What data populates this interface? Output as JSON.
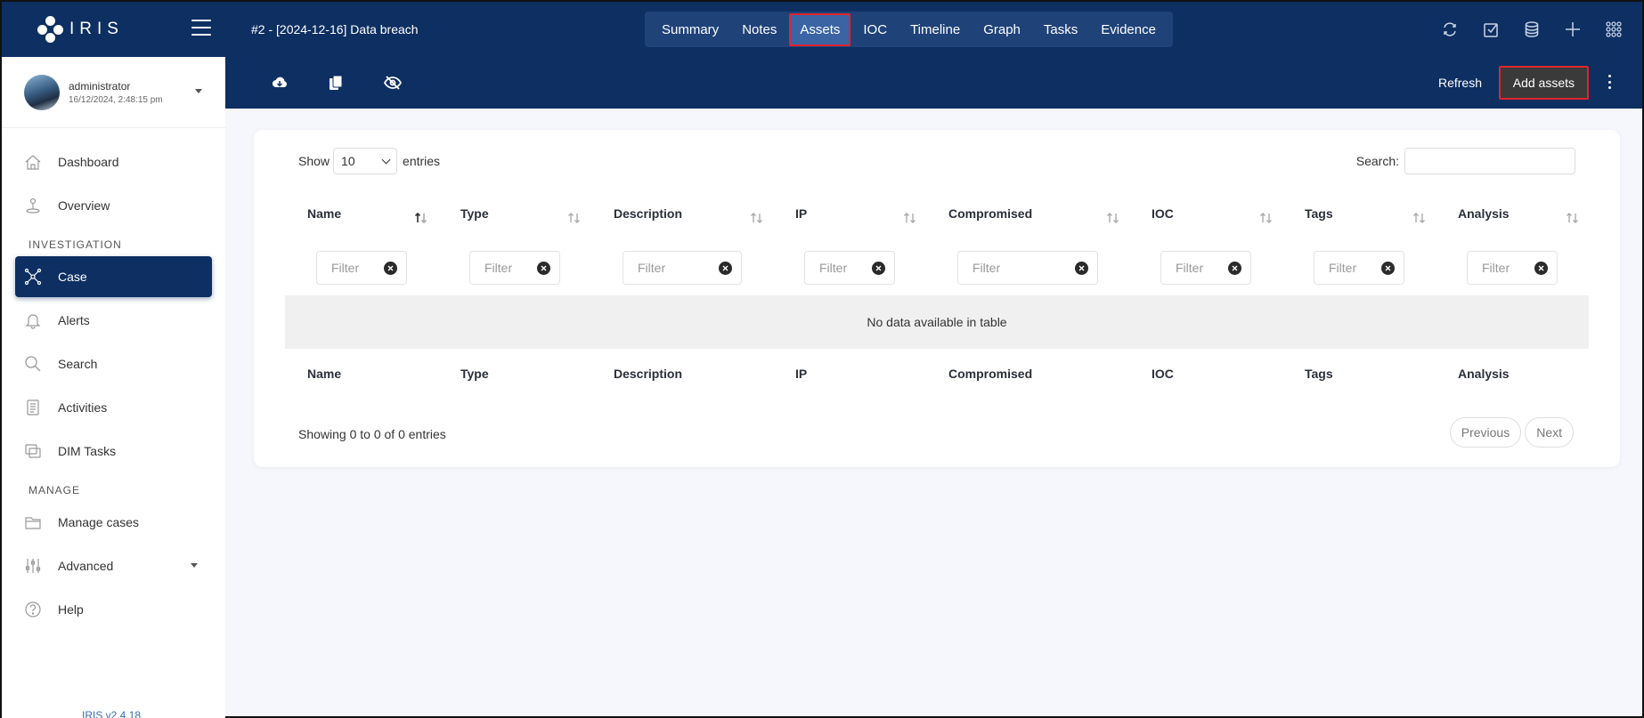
{
  "app": {
    "logo_text": "IRIS",
    "case_title": "#2 - [2024-12-16] Data breach",
    "version": "IRIS v2.4.18"
  },
  "nav": {
    "tabs": [
      {
        "label": "Summary"
      },
      {
        "label": "Notes"
      },
      {
        "label": "Assets",
        "active": true
      },
      {
        "label": "IOC"
      },
      {
        "label": "Timeline"
      },
      {
        "label": "Graph"
      },
      {
        "label": "Tasks"
      },
      {
        "label": "Evidence"
      }
    ]
  },
  "user": {
    "name": "administrator",
    "timestamp": "16/12/2024, 2:48:15 pm"
  },
  "sidebar": {
    "dashboard": "Dashboard",
    "overview": "Overview",
    "section_investigation": "INVESTIGATION",
    "case": "Case",
    "alerts": "Alerts",
    "search": "Search",
    "activities": "Activities",
    "dim_tasks": "DIM Tasks",
    "section_manage": "MANAGE",
    "manage_cases": "Manage cases",
    "advanced": "Advanced",
    "help": "Help"
  },
  "toolbar": {
    "refresh": "Refresh",
    "add_assets": "Add assets"
  },
  "table": {
    "show_label": "Show",
    "entries_label": "entries",
    "page_size": "10",
    "search_label": "Search:",
    "columns": [
      "Name",
      "Type",
      "Description",
      "IP",
      "Compromised",
      "IOC",
      "Tags",
      "Analysis"
    ],
    "filter_placeholder": "Filter",
    "empty": "No data available in table",
    "info": "Showing 0 to 0 of 0 entries",
    "previous": "Previous",
    "next": "Next"
  },
  "colors": {
    "primary": "#0d2f62",
    "active_outline": "#e0252c",
    "add_button_bg": "#3a3a3a"
  }
}
